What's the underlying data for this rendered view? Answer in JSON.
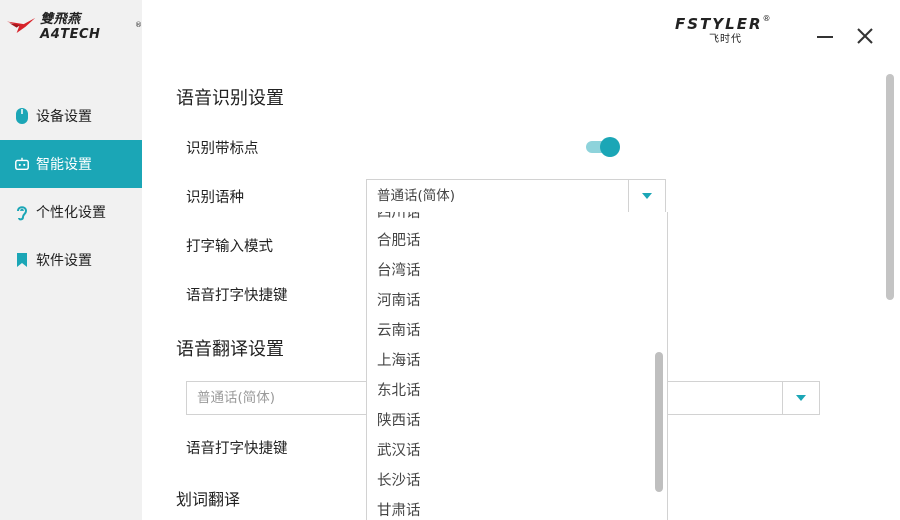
{
  "brand": {
    "name": "雙飛燕 A4TECH",
    "reg": "®"
  },
  "logo": {
    "main": "FSTYLER",
    "sub": "飞时代",
    "reg": "®"
  },
  "sidebar": {
    "items": [
      {
        "label": "设备设置",
        "icon": "mouse-icon",
        "active": false
      },
      {
        "label": "智能设置",
        "icon": "robot-icon",
        "active": true
      },
      {
        "label": "个性化设置",
        "icon": "ear-icon",
        "active": false
      },
      {
        "label": "软件设置",
        "icon": "bookmark-icon",
        "active": false
      }
    ]
  },
  "speech_recognition": {
    "title": "语音识别设置",
    "punctuation_label": "识别带标点",
    "punctuation_on": true,
    "language_label": "识别语种",
    "language_value": "普通话(简体)",
    "typing_mode_label": "打字输入模式",
    "shortcut_label": "语音打字快捷键"
  },
  "language_dropdown": {
    "partial_top": "四川话",
    "options": [
      "合肥话",
      "台湾话",
      "河南话",
      "云南话",
      "上海话",
      "东北话",
      "陕西话",
      "武汉话",
      "长沙话",
      "甘肃话"
    ]
  },
  "translation": {
    "title": "语音翻译设置",
    "language_value": "普通话(简体)",
    "shortcut_label": "语音打字快捷键",
    "partial_label": "划词翻译"
  },
  "colors": {
    "accent": "#1ba6b6",
    "accent_light": "#8ed3db",
    "sidebar_bg": "#f1f1f1"
  }
}
